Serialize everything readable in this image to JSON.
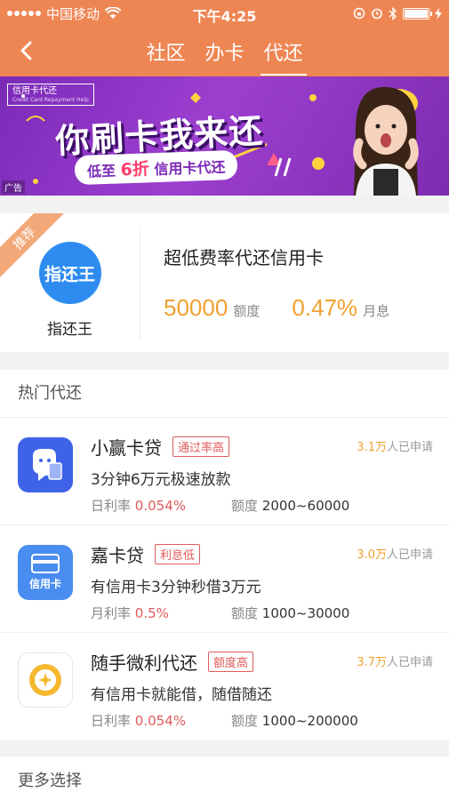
{
  "status_bar": {
    "carrier": "中国移动",
    "time": "下午4:25"
  },
  "nav": {
    "tabs": [
      {
        "label": "社区"
      },
      {
        "label": "办卡"
      },
      {
        "label": "代还"
      }
    ],
    "active_tab": "代还"
  },
  "banner": {
    "badge": "信用卡代还",
    "title": "你刷卡我来还",
    "pill_prefix": "低至",
    "pill_discount": "6折",
    "pill_suffix": "信用卡代还",
    "ad_label": "广告"
  },
  "recommend": {
    "ribbon": "推荐",
    "logo_text": "指还王",
    "name": "指还王",
    "title": "超低费率代还信用卡",
    "limit_value": "50000",
    "limit_unit": "额度",
    "rate_value": "0.47%",
    "rate_unit": "月息"
  },
  "hot": {
    "title": "热门代还",
    "items": [
      {
        "name": "小赢卡贷",
        "tag": "通过率高",
        "applicants_num": "3.1万",
        "applicants_text": "人已申请",
        "desc": "3分钟6万元极速放款",
        "rate_label": "日利率",
        "rate_value": "0.054%",
        "limit_label": "额度",
        "limit_value": "2000~60000",
        "icon": "robot-card-icon",
        "icon_color": "#3f63e8"
      },
      {
        "name": "嘉卡贷",
        "tag": "利息低",
        "applicants_num": "3.0万",
        "applicants_text": "人已申请",
        "desc": "有信用卡3分钟秒借3万元",
        "rate_label": "月利率",
        "rate_value": "0.5%",
        "limit_label": "额度",
        "limit_value": "1000~30000",
        "icon": "credit-card-icon",
        "icon_text": "信用卡",
        "icon_color": "#4a8df0"
      },
      {
        "name": "随手微利代还",
        "tag": "额度高",
        "applicants_num": "3.7万",
        "applicants_text": "人已申请",
        "desc": "有信用卡就能借，随借随还",
        "rate_label": "日利率",
        "rate_value": "0.054%",
        "limit_label": "额度",
        "limit_value": "1000~200000",
        "icon": "star-coin-icon",
        "icon_color": "#f5b82e"
      }
    ]
  },
  "more": {
    "title": "更多选择"
  },
  "colors": {
    "header": "#ee8654",
    "accent": "#f0a030",
    "tag_red": "#e05a5a"
  }
}
